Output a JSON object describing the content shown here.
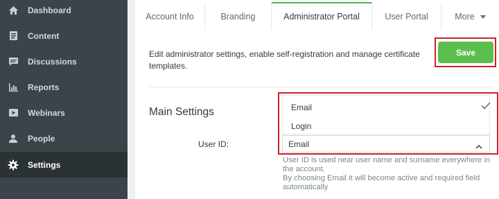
{
  "sidebar": {
    "items": [
      {
        "label": "Dashboard",
        "icon": "home-icon",
        "active": false
      },
      {
        "label": "Content",
        "icon": "document-icon",
        "active": false
      },
      {
        "label": "Discussions",
        "icon": "chat-icon",
        "active": false
      },
      {
        "label": "Reports",
        "icon": "bar-chart-icon",
        "active": false
      },
      {
        "label": "Webinars",
        "icon": "video-icon",
        "active": false
      },
      {
        "label": "People",
        "icon": "person-icon",
        "active": false
      },
      {
        "label": "Settings",
        "icon": "gear-icon",
        "active": true
      }
    ]
  },
  "tabs": [
    {
      "label": "Account Info"
    },
    {
      "label": "Branding"
    },
    {
      "label": "Administrator Portal",
      "active": true
    },
    {
      "label": "User Portal"
    },
    {
      "label": "More"
    }
  ],
  "page": {
    "description": "Edit administrator settings, enable self-registration and manage certificate templates.",
    "save_label": "Save",
    "section_title": "Main Settings"
  },
  "user_id": {
    "label": "User ID:",
    "options": [
      "Email",
      "Login"
    ],
    "selected": "Email",
    "help_line1": "User ID is used near user name and surname everywhere in the account.",
    "help_line2": "By choosing Email it will become active and required field automatically"
  },
  "colors": {
    "sidebar_bg": "#3c4449",
    "sidebar_active": "#2b3236",
    "accent_green": "#5cbf4d",
    "highlight_red": "#cc1f2b"
  }
}
